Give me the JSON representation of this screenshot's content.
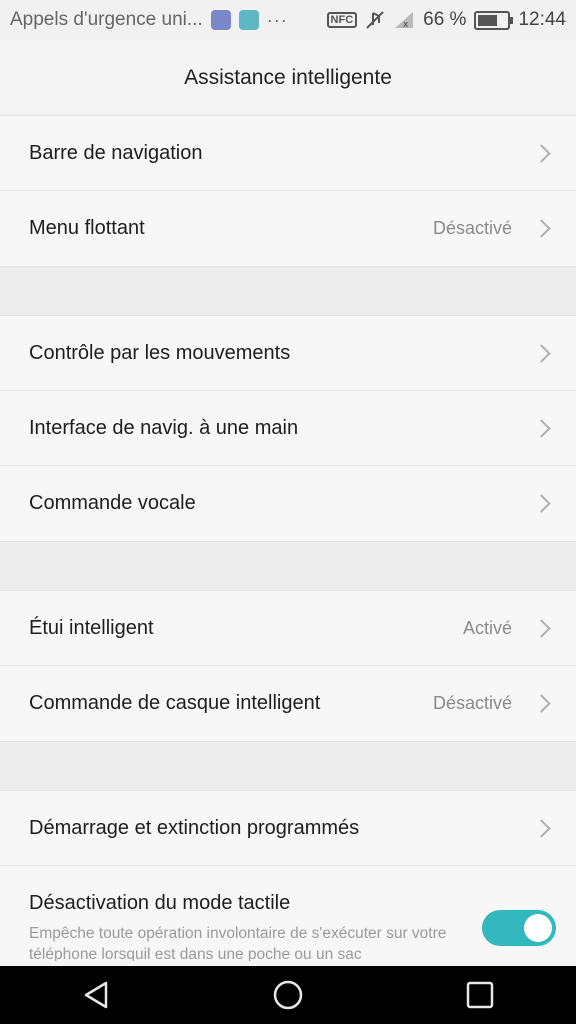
{
  "status_bar": {
    "notification_text": "Appels d'urgence uni...",
    "more": "···",
    "nfc": "NFC",
    "battery_text": "66 %",
    "battery_level": 0.66,
    "time": "12:44"
  },
  "header": {
    "title": "Assistance intelligente"
  },
  "groups": [
    [
      {
        "label": "Barre de navigation",
        "status": ""
      },
      {
        "label": "Menu flottant",
        "status": "Désactivé"
      }
    ],
    [
      {
        "label": "Contrôle par les mouvements",
        "status": ""
      },
      {
        "label": "Interface de navig. à une main",
        "status": ""
      },
      {
        "label": "Commande vocale",
        "status": ""
      }
    ],
    [
      {
        "label": "Étui intelligent",
        "status": "Activé"
      },
      {
        "label": "Commande de casque intelligent",
        "status": "Désactivé"
      }
    ],
    [
      {
        "label": "Démarrage et extinction programmés",
        "status": ""
      },
      {
        "label": "Désactivation du mode tactile",
        "description": "Empêche toute opération involontaire de s'exécuter sur votre téléphone lorsquil est dans une poche ou un sac",
        "toggle_on": true
      }
    ]
  ],
  "colors": {
    "accent": "#33b8bd",
    "background": "#f4f4f4",
    "navbar": "#000000"
  },
  "navbar": {
    "icons": [
      "back-icon",
      "home-icon",
      "recents-icon"
    ]
  }
}
